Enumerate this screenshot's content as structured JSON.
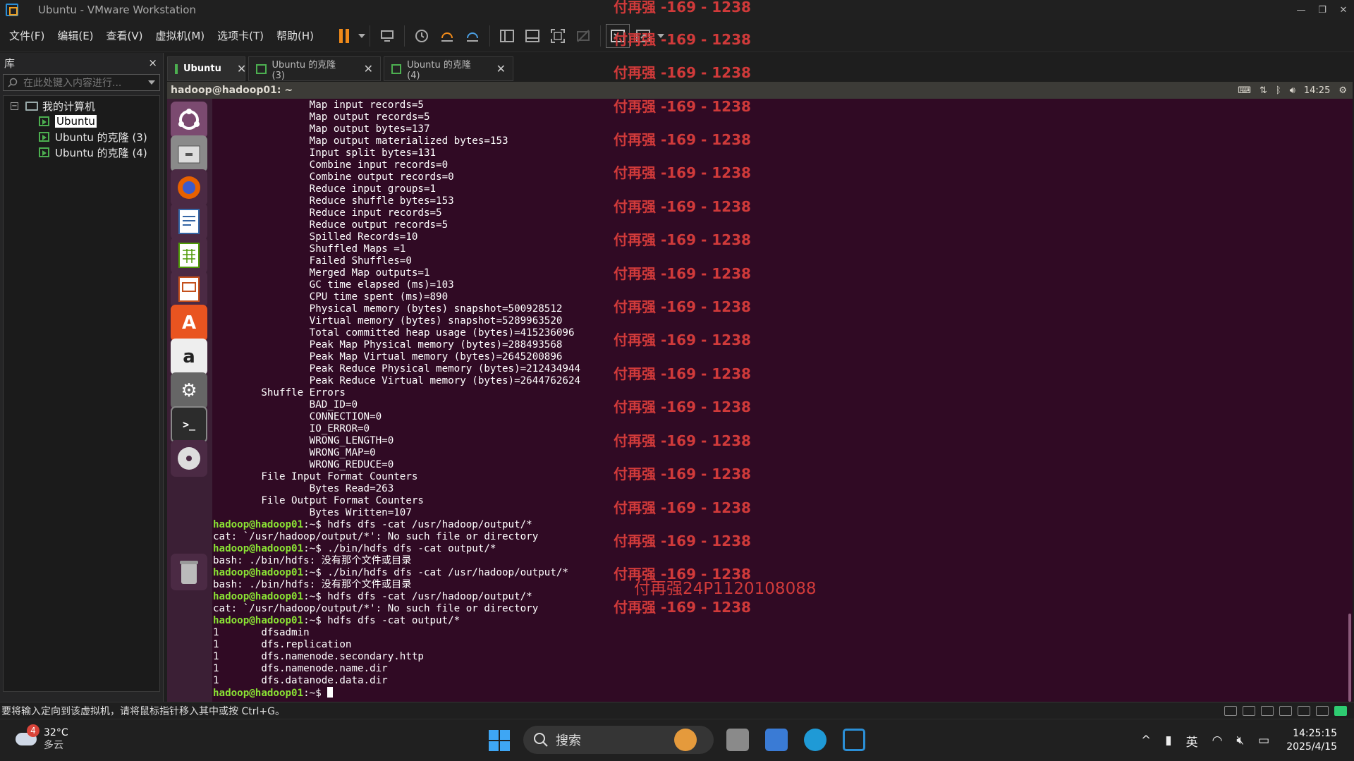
{
  "window": {
    "title": "Ubuntu - VMware Workstation"
  },
  "menu": [
    "文件(F)",
    "编辑(E)",
    "查看(V)",
    "虚拟机(M)",
    "选项卡(T)",
    "帮助(H)"
  ],
  "library": {
    "title": "库",
    "close": "×",
    "search_placeholder": "在此处键入内容进行...",
    "root": "我的计算机",
    "items": [
      "Ubuntu",
      "Ubuntu 的克隆 (3)",
      "Ubuntu 的克隆 (4)"
    ]
  },
  "tabs": [
    {
      "label": "Ubuntu"
    },
    {
      "label": "Ubuntu 的克隆 (3)"
    },
    {
      "label": "Ubuntu 的克隆 (4)"
    }
  ],
  "ubuntu_panel": {
    "title": "hadoop@hadoop01: ~",
    "time": "14:25"
  },
  "terminal": {
    "lines": [
      {
        "t": "\t\tMap input records=5"
      },
      {
        "t": "\t\tMap output records=5"
      },
      {
        "t": "\t\tMap output bytes=137"
      },
      {
        "t": "\t\tMap output materialized bytes=153"
      },
      {
        "t": "\t\tInput split bytes=131"
      },
      {
        "t": "\t\tCombine input records=0"
      },
      {
        "t": "\t\tCombine output records=0"
      },
      {
        "t": "\t\tReduce input groups=1"
      },
      {
        "t": "\t\tReduce shuffle bytes=153"
      },
      {
        "t": "\t\tReduce input records=5"
      },
      {
        "t": "\t\tReduce output records=5"
      },
      {
        "t": "\t\tSpilled Records=10"
      },
      {
        "t": "\t\tShuffled Maps =1"
      },
      {
        "t": "\t\tFailed Shuffles=0"
      },
      {
        "t": "\t\tMerged Map outputs=1"
      },
      {
        "t": "\t\tGC time elapsed (ms)=103"
      },
      {
        "t": "\t\tCPU time spent (ms)=890"
      },
      {
        "t": "\t\tPhysical memory (bytes) snapshot=500928512"
      },
      {
        "t": "\t\tVirtual memory (bytes) snapshot=5289963520"
      },
      {
        "t": "\t\tTotal committed heap usage (bytes)=415236096"
      },
      {
        "t": "\t\tPeak Map Physical memory (bytes)=288493568"
      },
      {
        "t": "\t\tPeak Map Virtual memory (bytes)=2645200896"
      },
      {
        "t": "\t\tPeak Reduce Physical memory (bytes)=212434944"
      },
      {
        "t": "\t\tPeak Reduce Virtual memory (bytes)=2644762624"
      },
      {
        "t": "\tShuffle Errors"
      },
      {
        "t": "\t\tBAD_ID=0"
      },
      {
        "t": "\t\tCONNECTION=0"
      },
      {
        "t": "\t\tIO_ERROR=0"
      },
      {
        "t": "\t\tWRONG_LENGTH=0"
      },
      {
        "t": "\t\tWRONG_MAP=0"
      },
      {
        "t": "\t\tWRONG_REDUCE=0"
      },
      {
        "t": "\tFile Input Format Counters "
      },
      {
        "t": "\t\tBytes Read=263"
      },
      {
        "t": "\tFile Output Format Counters "
      },
      {
        "t": "\t\tBytes Written=107"
      },
      {
        "p": "hadoop@hadoop01",
        "t": ":~$ hdfs dfs -cat /usr/hadoop/output/*"
      },
      {
        "t": "cat: `/usr/hadoop/output/*': No such file or directory"
      },
      {
        "p": "hadoop@hadoop01",
        "t": ":~$ ./bin/hdfs dfs -cat output/*"
      },
      {
        "t": "bash: ./bin/hdfs: 没有那个文件或目录"
      },
      {
        "p": "hadoop@hadoop01",
        "t": ":~$ ./bin/hdfs dfs -cat /usr/hadoop/output/*"
      },
      {
        "t": "bash: ./bin/hdfs: 没有那个文件或目录"
      },
      {
        "p": "hadoop@hadoop01",
        "t": ":~$ hdfs dfs -cat /usr/hadoop/output/*"
      },
      {
        "t": "cat: `/usr/hadoop/output/*': No such file or directory"
      },
      {
        "p": "hadoop@hadoop01",
        "t": ":~$ hdfs dfs -cat output/*"
      },
      {
        "t": "1\tdfsadmin"
      },
      {
        "t": "1\tdfs.replication"
      },
      {
        "t": "1\tdfs.namenode.secondary.http"
      },
      {
        "t": "1\tdfs.namenode.name.dir"
      },
      {
        "t": "1\tdfs.datanode.data.dir"
      },
      {
        "p": "hadoop@hadoop01",
        "t": ":~$ ",
        "cursor": true
      }
    ]
  },
  "watermark": {
    "text": "付再强 -169 - 1238",
    "special": "付再强24P1120108088"
  },
  "statusbar": {
    "message": "要将输入定向到该虚拟机，请将鼠标指针移入其中或按 Ctrl+G。"
  },
  "taskbar": {
    "weather_badge": "4",
    "temperature": "32°C",
    "condition": "多云",
    "search_label": "搜索",
    "ime": "英",
    "time": "14:25:15",
    "date": "2025/4/15"
  },
  "colors": {
    "terminal_bg": "#300a24",
    "prompt": "#8ae234",
    "watermark": "#d03a3a",
    "accent": "#f08a1a"
  }
}
